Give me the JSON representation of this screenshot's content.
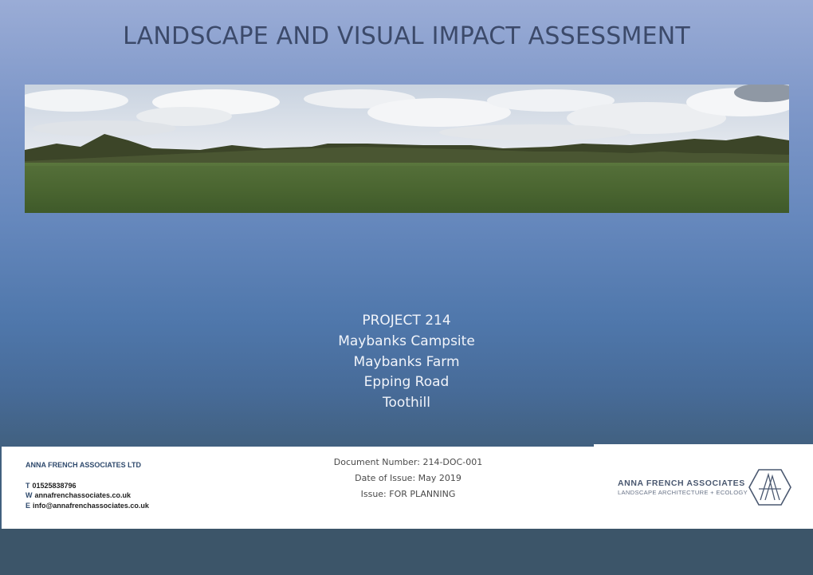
{
  "document": {
    "title": "LANDSCAPE AND VISUAL IMPACT ASSESSMENT",
    "project_lines": [
      "PROJECT 214",
      "Maybanks Campsite",
      "Maybanks Farm",
      "Epping Road",
      "Toothill"
    ]
  },
  "footer": {
    "company": "ANNA FRENCH ASSOCIATES LTD",
    "contacts": [
      {
        "key": "T",
        "value": "01525838796"
      },
      {
        "key": "W",
        "value": "annafrenchassociates.co.uk"
      },
      {
        "key": "E",
        "value": "info@annafrenchassociates.co.uk"
      }
    ],
    "document_number": "Document Number:  214-DOC-001",
    "date_of_issue": "Date of Issue: May 2019",
    "issue": "Issue: FOR PLANNING",
    "brand_name": "ANNA FRENCH ASSOCIATES",
    "brand_tagline": "LANDSCAPE ARCHITECTURE + ECOLOGY"
  },
  "colors": {
    "heading": "#3c4a6a",
    "brand": "#2f4a6d",
    "bottom_band": "#3c5569"
  },
  "icons": {
    "logo": "hexagon-aa-monogram-icon"
  }
}
